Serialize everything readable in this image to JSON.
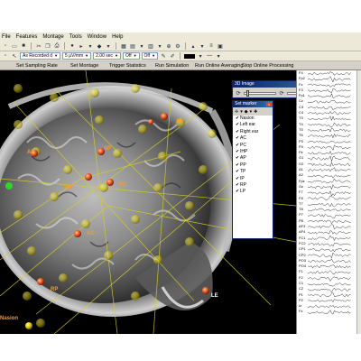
{
  "menu": {
    "items": [
      "File",
      "Features",
      "Montage",
      "Tools",
      "Window",
      "Help"
    ]
  },
  "toolbar2": {
    "combos": [
      "As Recorded d",
      "5 µV/mm",
      "2.00 sec",
      "Off",
      "Off"
    ]
  },
  "actionbar": {
    "items": [
      "Set Sampling Rate",
      "Set Montage",
      "Trigger Statistics",
      "Run Simulation",
      "Run Online Averaging",
      "Stop Online Processing"
    ]
  },
  "viewer": {
    "marker_labels": [
      "IP",
      "SP",
      "AP",
      "IHP",
      "PC",
      "AC",
      "RP",
      "LE",
      "Nasion"
    ]
  },
  "image3d": {
    "title": "3D Image"
  },
  "setmarker": {
    "title": "Set marker",
    "items": [
      "Nasion",
      "Left ear",
      "Right ear",
      "AC",
      "PC",
      "IHP",
      "AP",
      "PP",
      "TP",
      "IP",
      "RP",
      "LP"
    ]
  },
  "eeg": {
    "channels": [
      "F4",
      "Fp2",
      "Fz",
      "F3",
      "Fp1",
      "Cz",
      "C3",
      "C4",
      "T3",
      "T4",
      "T5",
      "T6",
      "P3",
      "P4",
      "Pz",
      "O1",
      "O2",
      "A1",
      "A2",
      "Fpz",
      "Oz",
      "F7",
      "F8",
      "T7",
      "T8",
      "P7",
      "P8",
      "AF3",
      "AF4",
      "FC1",
      "FC2",
      "CP1",
      "CP2",
      "PO3",
      "PO4",
      "F1",
      "F2",
      "C1",
      "C2",
      "P1",
      "P2",
      "Iz",
      "Fz"
    ]
  },
  "colors": {
    "marker_orange": "#ff6a1a",
    "marker_yellow": "#e8d800",
    "titlebar": "#0a246a"
  }
}
